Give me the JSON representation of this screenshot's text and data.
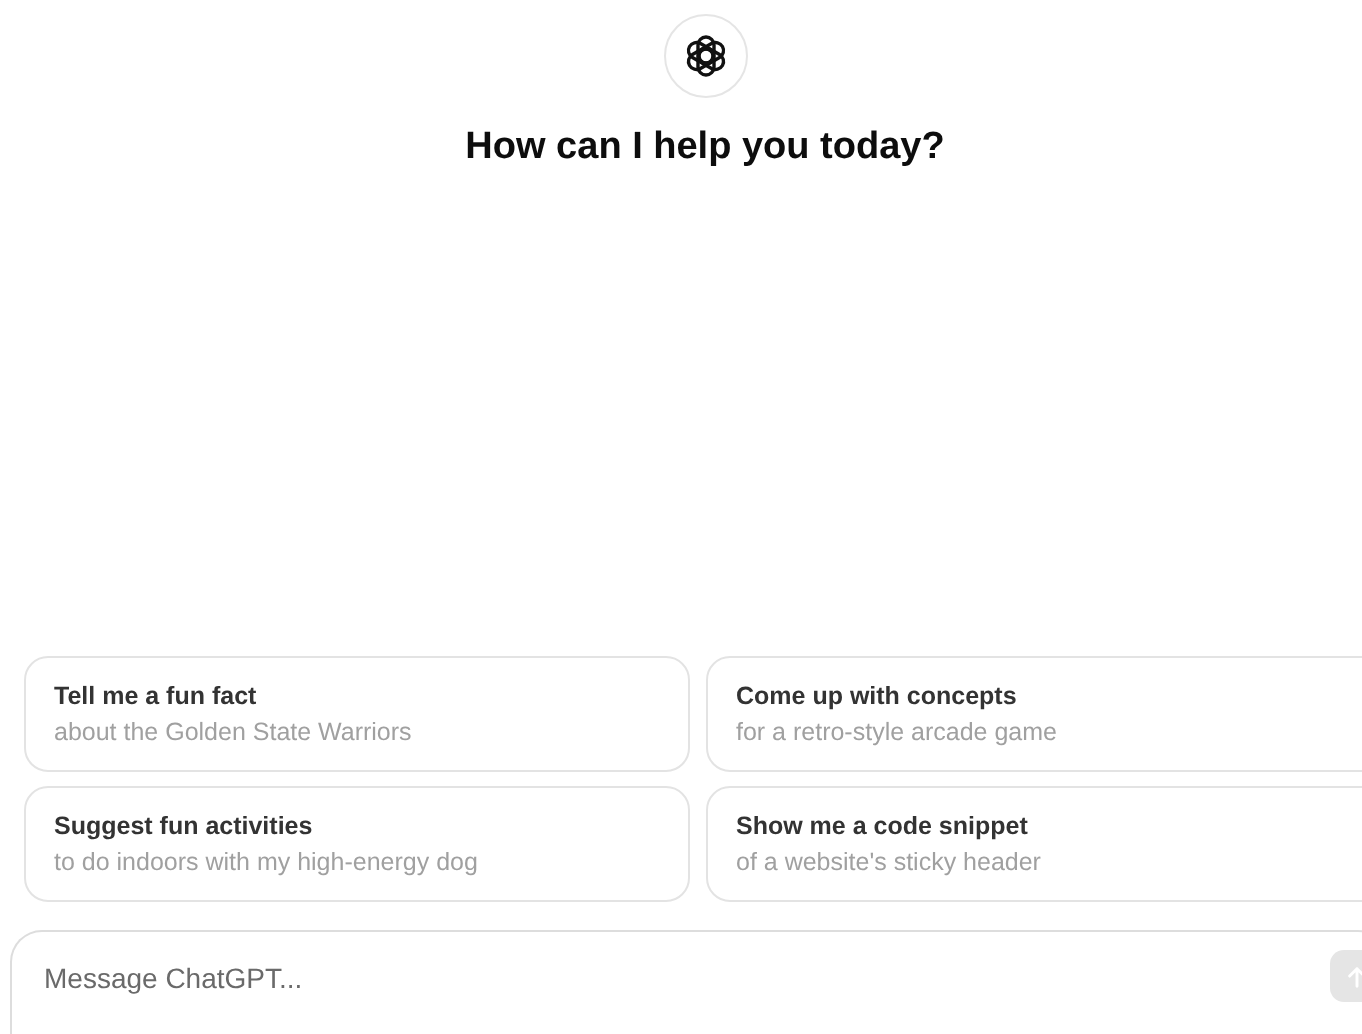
{
  "heading": "How can I help you today?",
  "suggestions": [
    {
      "title": "Tell me a fun fact",
      "subtitle": "about the Golden State Warriors"
    },
    {
      "title": "Come up with concepts",
      "subtitle": "for a retro-style arcade game"
    },
    {
      "title": "Suggest fun activities",
      "subtitle": "to do indoors with my high-energy dog"
    },
    {
      "title": "Show me a code snippet",
      "subtitle": "of a website's sticky header"
    }
  ],
  "composer": {
    "placeholder": "Message ChatGPT...",
    "send_disabled": true
  }
}
